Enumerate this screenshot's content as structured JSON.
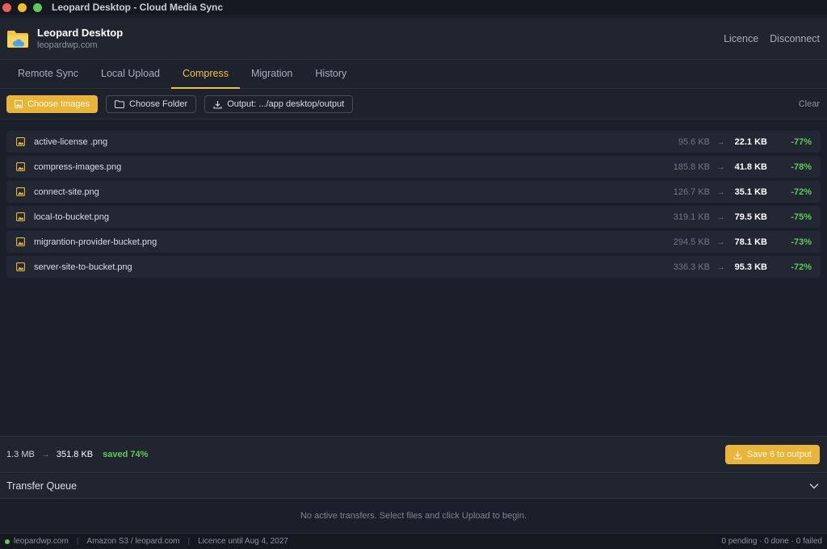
{
  "window": {
    "title": "Leopard Desktop - Cloud Media Sync"
  },
  "header": {
    "site_name": "Leopard Desktop",
    "site_domain": "leopardwp.com",
    "licence_label": "Licence",
    "disconnect_label": "Disconnect"
  },
  "tabs": [
    {
      "label": "Remote Sync",
      "active": false
    },
    {
      "label": "Local Upload",
      "active": false
    },
    {
      "label": "Compress",
      "active": true
    },
    {
      "label": "Migration",
      "active": false
    },
    {
      "label": "History",
      "active": false
    }
  ],
  "toolbar": {
    "choose_images": "Choose Images",
    "choose_folder": "Choose Folder",
    "output": "Output: .../app desktop/output",
    "clear": "Clear"
  },
  "files": [
    {
      "name": "active-license .png",
      "original": "95.6 KB",
      "compressed": "22.1 KB",
      "saving": "-77%"
    },
    {
      "name": "compress-images.png",
      "original": "185.8 KB",
      "compressed": "41.8 KB",
      "saving": "-78%"
    },
    {
      "name": "connect-site.png",
      "original": "126.7 KB",
      "compressed": "35.1 KB",
      "saving": "-72%"
    },
    {
      "name": "local-to-bucket.png",
      "original": "319.1 KB",
      "compressed": "79.5 KB",
      "saving": "-75%"
    },
    {
      "name": "migrantion-provider-bucket.png",
      "original": "294.5 KB",
      "compressed": "78.1 KB",
      "saving": "-73%"
    },
    {
      "name": "server-site-to-bucket.png",
      "original": "336.3 KB",
      "compressed": "95.3 KB",
      "saving": "-72%"
    }
  ],
  "summary": {
    "original_total": "1.3 MB",
    "compressed_total": "351.8 KB",
    "saved": "saved 74%",
    "save_button": "Save 6 to output"
  },
  "queue": {
    "title": "Transfer Queue",
    "empty_message": "No active transfers. Select files and click Upload to begin."
  },
  "statusbar": {
    "site": "leopardwp.com",
    "provider": "Amazon S3 / leopard.com",
    "licence": "Licence until Aug 4, 2027",
    "counts": "0 pending · 0 done · 0 failed"
  },
  "colors": {
    "accent": "#e8b53a",
    "success": "#5fc95a",
    "background": "#1b1f2a"
  }
}
